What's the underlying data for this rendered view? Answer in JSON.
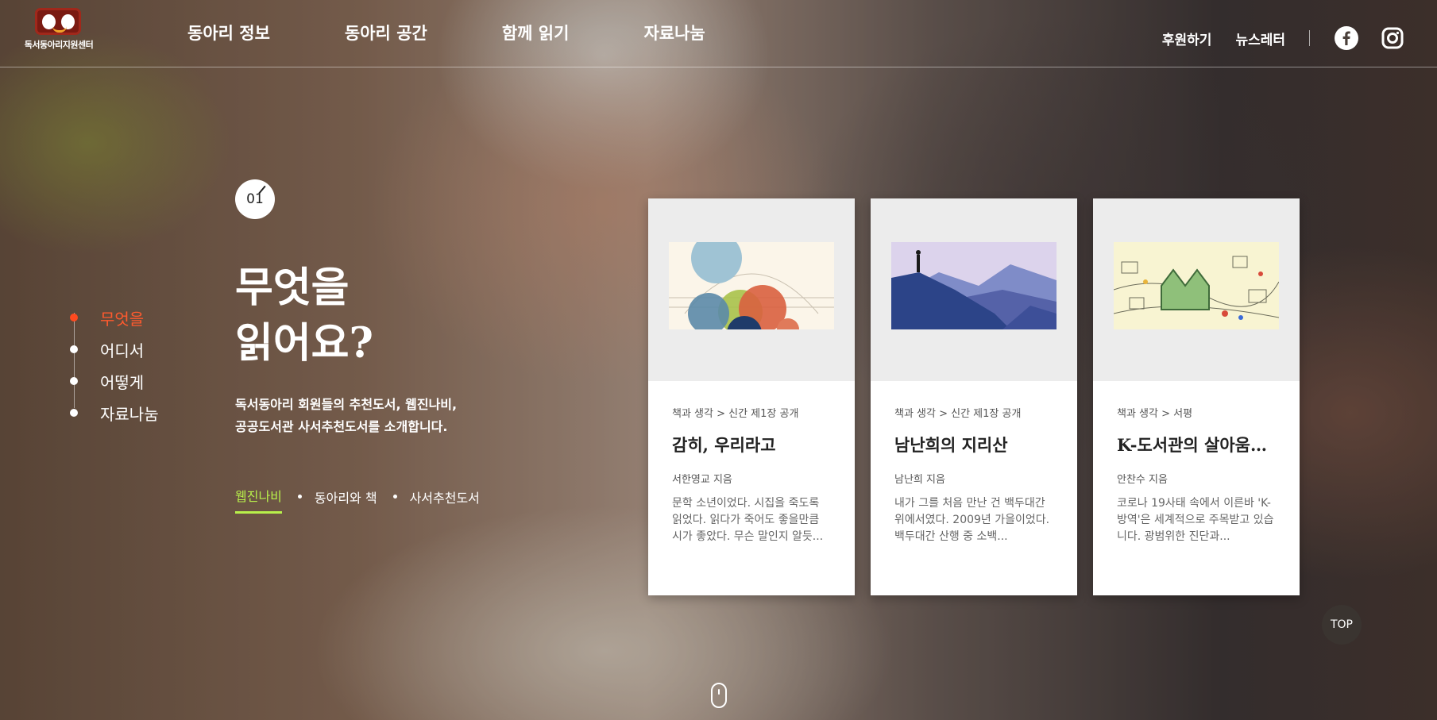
{
  "header": {
    "logo_text": "독서동아리지원센터",
    "nav": [
      "동아리 정보",
      "동아리 공간",
      "함께 읽기",
      "자료나눔"
    ],
    "util": {
      "donate": "후원하기",
      "newsletter": "뉴스레터"
    },
    "sns": [
      "facebook-icon",
      "instagram-icon"
    ]
  },
  "sidenav": {
    "items": [
      "무엇을",
      "어디서",
      "어떻게",
      "자료나눔"
    ],
    "active_index": 0,
    "active_color": "#ff4a1f"
  },
  "section": {
    "number": "01",
    "title_line1": "무엇을",
    "title_line2": "읽어요?",
    "desc_line1": "독서동아리 회원들의 추천도서, 웹진나비,",
    "desc_line2": "공공도서관 사서추천도서를 소개합니다.",
    "tabs": [
      "웹진나비",
      "동아리와 책",
      "사서추천도서"
    ],
    "active_tab_color": "#b8f04b"
  },
  "cards": [
    {
      "category": "책과 생각 > 신간 제1장 공개",
      "title": "감히, 우리라고",
      "author": "서한영교 지음",
      "excerpt": "문학 소년이었다. 시집을 죽도록 읽었다. 읽다가 죽어도 좋을만큼 시가 좋았다. 무슨 말인지 알듯..."
    },
    {
      "category": "책과 생각 > 신간 제1장 공개",
      "title": "남난희의 지리산",
      "author": "남난희 지음",
      "excerpt": "내가 그를 처음 만난 건 백두대간 위에서였다. 2009년 가을이었다. 백두대간 산행 중 소백..."
    },
    {
      "category": "책과 생각 > 서평",
      "title": "K-도서관의 살아움…",
      "author": "안찬수 지음",
      "excerpt": "코로나 19사태 속에서 이른바 'K-방역'은 세계적으로 주목받고 있습니다. 광범위한 진단과..."
    }
  ],
  "top_button": "TOP"
}
